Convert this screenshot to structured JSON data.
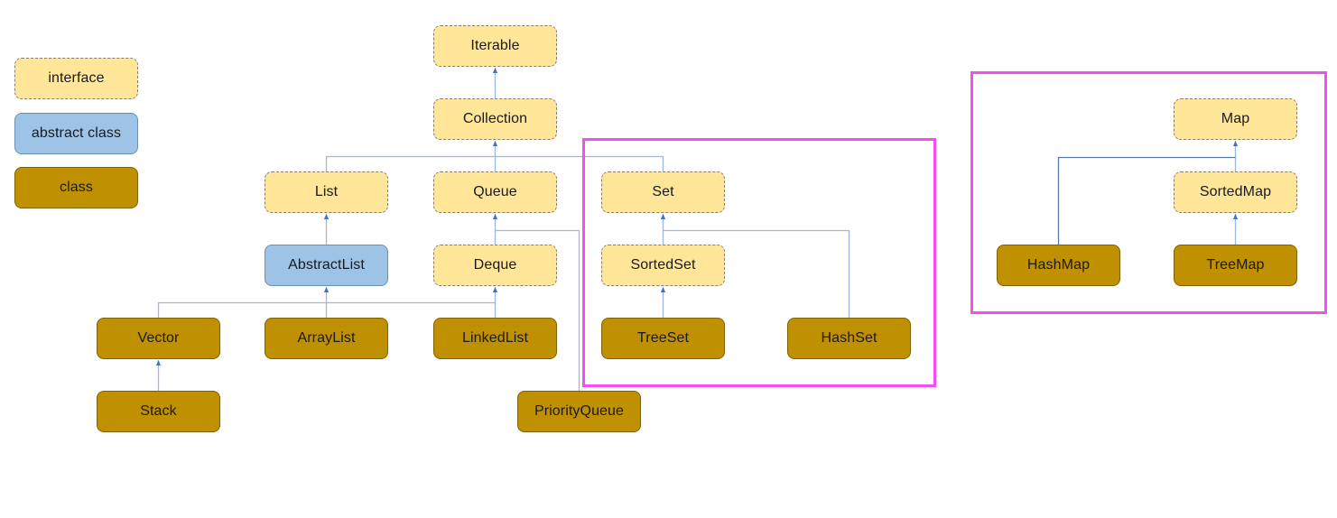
{
  "legend": [
    {
      "label": "interface",
      "kind": "interface"
    },
    {
      "label": "abstract class",
      "kind": "abstract"
    },
    {
      "label": "class",
      "kind": "class"
    }
  ],
  "nodes": {
    "iterable": {
      "label": "Iterable",
      "kind": "interface",
      "parent": null
    },
    "collection": {
      "label": "Collection",
      "kind": "interface",
      "parent": "iterable"
    },
    "list": {
      "label": "List",
      "kind": "interface",
      "parent": "collection"
    },
    "queue": {
      "label": "Queue",
      "kind": "interface",
      "parent": "collection"
    },
    "set": {
      "label": "Set",
      "kind": "interface",
      "parent": "collection"
    },
    "abstractlist": {
      "label": "AbstractList",
      "kind": "abstract",
      "parent": "list"
    },
    "deque": {
      "label": "Deque",
      "kind": "interface",
      "parent": "queue"
    },
    "sortedset": {
      "label": "SortedSet",
      "kind": "interface",
      "parent": "set"
    },
    "vector": {
      "label": "Vector",
      "kind": "class",
      "parent": "abstractlist"
    },
    "arraylist": {
      "label": "ArrayList",
      "kind": "class",
      "parent": "abstractlist"
    },
    "linkedlist": {
      "label": "LinkedList",
      "kind": "class",
      "parent": "deque"
    },
    "treeset": {
      "label": "TreeSet",
      "kind": "class",
      "parent": "sortedset"
    },
    "hashset": {
      "label": "HashSet",
      "kind": "class",
      "parent": "set"
    },
    "stack": {
      "label": "Stack",
      "kind": "class",
      "parent": "vector"
    },
    "priorityqueue": {
      "label": "PriorityQueue",
      "kind": "class",
      "parent": "queue"
    },
    "map": {
      "label": "Map",
      "kind": "interface",
      "parent": null
    },
    "sortedmap": {
      "label": "SortedMap",
      "kind": "interface",
      "parent": "map"
    },
    "hashmap": {
      "label": "HashMap",
      "kind": "class",
      "parent": "map"
    },
    "treemap": {
      "label": "TreeMap",
      "kind": "class",
      "parent": "sortedmap"
    }
  },
  "highlight_groups": [
    {
      "name": "set-hierarchy",
      "members": [
        "set",
        "sortedset",
        "treeset",
        "hashset"
      ]
    },
    {
      "name": "map-hierarchy",
      "members": [
        "map",
        "sortedmap",
        "hashmap",
        "treemap"
      ]
    }
  ],
  "colors": {
    "interface": "#FFE699",
    "abstract": "#9DC3E6",
    "class": "#BF9000",
    "highlight": "#F24EF2",
    "connector": "#9DB9DF",
    "connector_dark": "#5B7BA6",
    "arrowhead": "#4472C4"
  }
}
